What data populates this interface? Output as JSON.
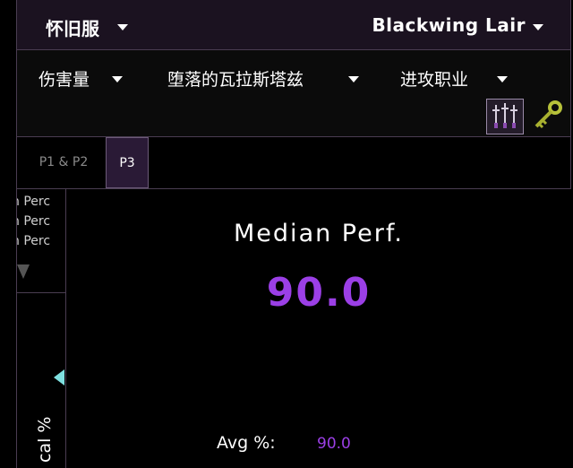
{
  "header": {
    "server_label": "怀旧服",
    "zone_label": "Blackwing Lair"
  },
  "filters": {
    "metric_label": "伤害量",
    "boss_label": "堕落的瓦拉斯塔兹",
    "role_label": "进攻职业"
  },
  "tabs": [
    {
      "label": "P1 & P2"
    },
    {
      "label": "P3"
    }
  ],
  "sidebar": {
    "lines": [
      "n Perc",
      "n Perc",
      "n Perc"
    ],
    "vertical_label": "cal %"
  },
  "main": {
    "title": "Median Perf.",
    "value": "90.0",
    "avg_label": "Avg %:",
    "avg_value": "90.0"
  },
  "colors": {
    "accent": "#9b3fe6",
    "header_bg": "#1b1220",
    "active_tab_bg": "#2a1a36",
    "scroll_arrow": "#7fe0e0"
  },
  "icons": [
    "swords-icon",
    "key-icon",
    "chevron-down-icon",
    "scroll-up-arrow-icon",
    "scroll-left-arrow-icon"
  ]
}
